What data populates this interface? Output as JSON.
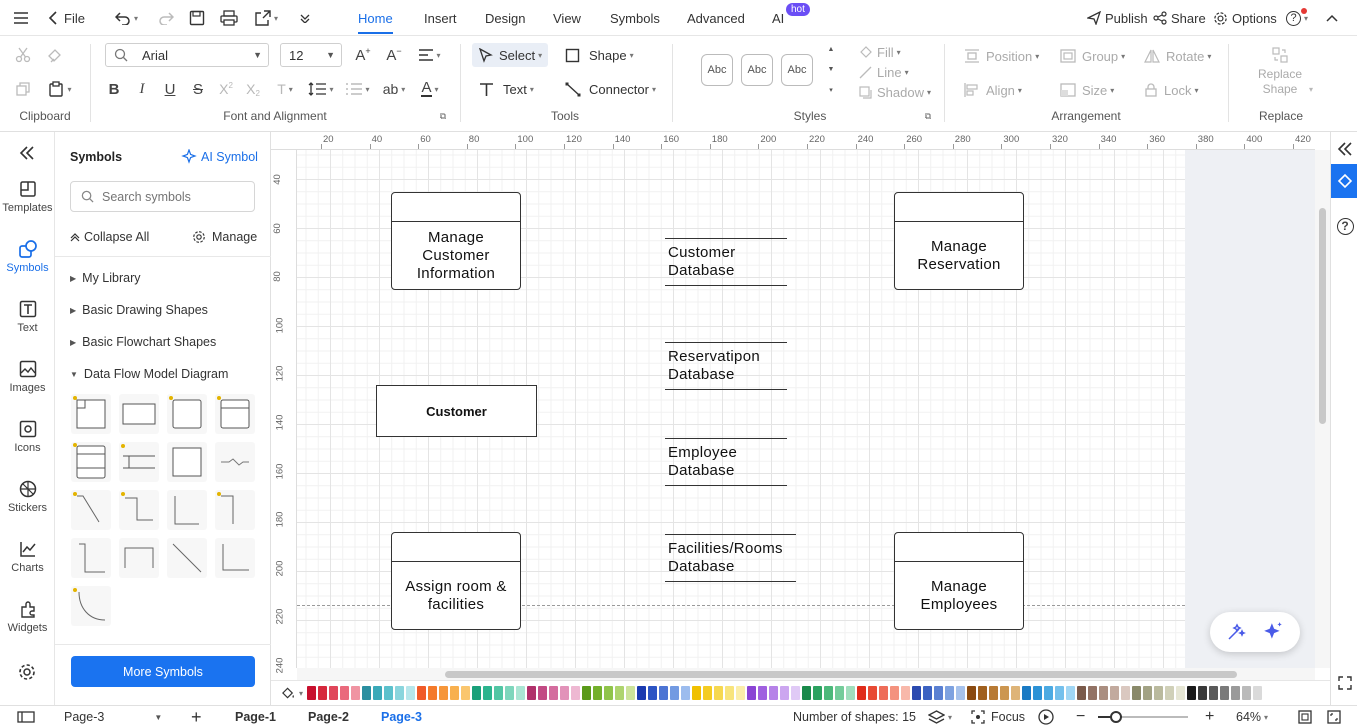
{
  "topbar": {
    "file_label": "File",
    "menu_tabs": [
      "Home",
      "Insert",
      "Design",
      "View",
      "Symbols",
      "Advanced",
      "AI"
    ],
    "hot_badge": "hot",
    "publish": "Publish",
    "share": "Share",
    "options": "Options",
    "help": "?"
  },
  "ribbon": {
    "groups": {
      "clipboard": "Clipboard",
      "font": "Font and Alignment",
      "tools": "Tools",
      "styles": "Styles",
      "arrangement": "Arrangement",
      "replace": "Replace"
    },
    "font_family": "Arial",
    "font_size": "12",
    "select": "Select",
    "shape": "Shape",
    "text": "Text",
    "connector": "Connector",
    "style_samples": [
      "Abc",
      "Abc",
      "Abc"
    ],
    "fill": "Fill",
    "line": "Line",
    "shadow": "Shadow",
    "position": "Position",
    "group": "Group",
    "rotate": "Rotate",
    "align": "Align",
    "size": "Size",
    "lock": "Lock",
    "replace_shape_1": "Replace",
    "replace_shape_2": "Shape"
  },
  "leftnav": {
    "items": [
      "Templates",
      "Symbols",
      "Text",
      "Images",
      "Icons",
      "Stickers",
      "Charts",
      "Widgets"
    ]
  },
  "symbols": {
    "title": "Symbols",
    "ai_symbol": "AI Symbol",
    "search_placeholder": "Search symbols",
    "collapse_all": "Collapse All",
    "manage": "Manage",
    "libraries": [
      "My Library",
      "Basic Drawing Shapes",
      "Basic Flowchart Shapes",
      "Data Flow Model Diagram"
    ],
    "more_symbols": "More Symbols"
  },
  "rulers": {
    "h_ticks": [
      "20",
      "40",
      "60",
      "80",
      "100",
      "120",
      "140",
      "160",
      "180",
      "200",
      "220",
      "240",
      "260",
      "280",
      "300",
      "320",
      "340",
      "360",
      "380",
      "400",
      "420"
    ],
    "v_ticks": [
      "40",
      "60",
      "80",
      "100",
      "120",
      "140",
      "160",
      "180",
      "200",
      "220",
      "240"
    ]
  },
  "diagram": {
    "processes": {
      "manage_customer": "Manage\nCustomer\nInformation",
      "manage_reservation": "Manage\nReservation",
      "assign_room": "Assign room &\nfacilities",
      "manage_employees": "Manage\nEmployees"
    },
    "stores": {
      "customer_db": "Customer\nDatabase",
      "reservation_db": "Reservatipon\nDatabase",
      "employee_db": "Employee\nDatabase",
      "facilities_db": "Facilities/Rooms\nDatabase"
    },
    "entity": "Customer"
  },
  "palette": [
    "#c8102e",
    "#d6283c",
    "#e0465a",
    "#ea6a7c",
    "#f094a2",
    "#2a8fa0",
    "#3aa9b8",
    "#5cc1cc",
    "#8ad5dd",
    "#b6e6eb",
    "#f05a28",
    "#f47a2a",
    "#f6963a",
    "#f8b04e",
    "#fac66e",
    "#1aa07a",
    "#2cb48e",
    "#52c6a4",
    "#7ed6bc",
    "#aae5d3",
    "#b0306a",
    "#c24a84",
    "#d46c9e",
    "#e292b9",
    "#eeb8d2",
    "#5a9a1a",
    "#74b02c",
    "#90c44a",
    "#aed46e",
    "#ccE39a",
    "#1a3ab0",
    "#2c54c4",
    "#4c74d4",
    "#729ae2",
    "#9cbcee",
    "#f0c000",
    "#f4cc22",
    "#f6d850",
    "#f8e47c",
    "#fbeeaa",
    "#8a44d4",
    "#a060e0",
    "#b682e8",
    "#cca6f0",
    "#e0caf6",
    "#1a8a4a",
    "#2ca260",
    "#4cb87a",
    "#74cc9a",
    "#a0debc",
    "#e02c1a",
    "#e84a34",
    "#ee6c58",
    "#f4927e",
    "#f8b8aa",
    "#2a4ab0",
    "#3c62c2",
    "#5a80d2",
    "#7ea2e0",
    "#a6c2ec",
    "#8a4a10",
    "#a0601e",
    "#b87a34",
    "#cc9650",
    "#deb478",
    "#1a7ac4",
    "#2c92d6",
    "#4caae2",
    "#74c0ec",
    "#a0d6f4",
    "#7a5a4a",
    "#927264",
    "#aa8e80",
    "#c2aa9e",
    "#dac8c0",
    "#8a8a6a",
    "#a2a284",
    "#baba9e",
    "#d0d0b8",
    "#e6e6d4",
    "#1a1a1a",
    "#3a3a3a",
    "#5a5a5a",
    "#7a7a7a",
    "#9a9a9a",
    "#bababa",
    "#dadada"
  ],
  "statusbar": {
    "page_select": "Page-3",
    "pages": [
      "Page-1",
      "Page-2",
      "Page-3"
    ],
    "shape_count": "Number of shapes: 15",
    "focus": "Focus",
    "zoom": "64%"
  }
}
